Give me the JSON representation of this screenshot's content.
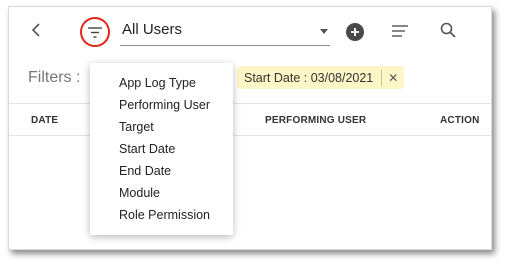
{
  "toolbar": {
    "back_icon": "chevron-left-icon",
    "filter_icon": "filter-lines-icon",
    "user_select_value": "All Users",
    "add_icon": "plus-circle-icon",
    "sort_icon": "sort-lines-icon",
    "search_icon": "search-icon",
    "highlight_color": "#e0241b"
  },
  "filters": {
    "label": "Filters :",
    "chip_text": "Start Date : 03/08/2021",
    "chip_color": "#fdf6c6",
    "chip_close": "✕"
  },
  "table": {
    "headers": [
      "DATE",
      "PERFORMING USER",
      "ACTION"
    ]
  },
  "filter_menu": {
    "items": [
      "App Log Type",
      "Performing User",
      "Target",
      "Start Date",
      "End Date",
      "Module",
      "Role Permission"
    ]
  }
}
